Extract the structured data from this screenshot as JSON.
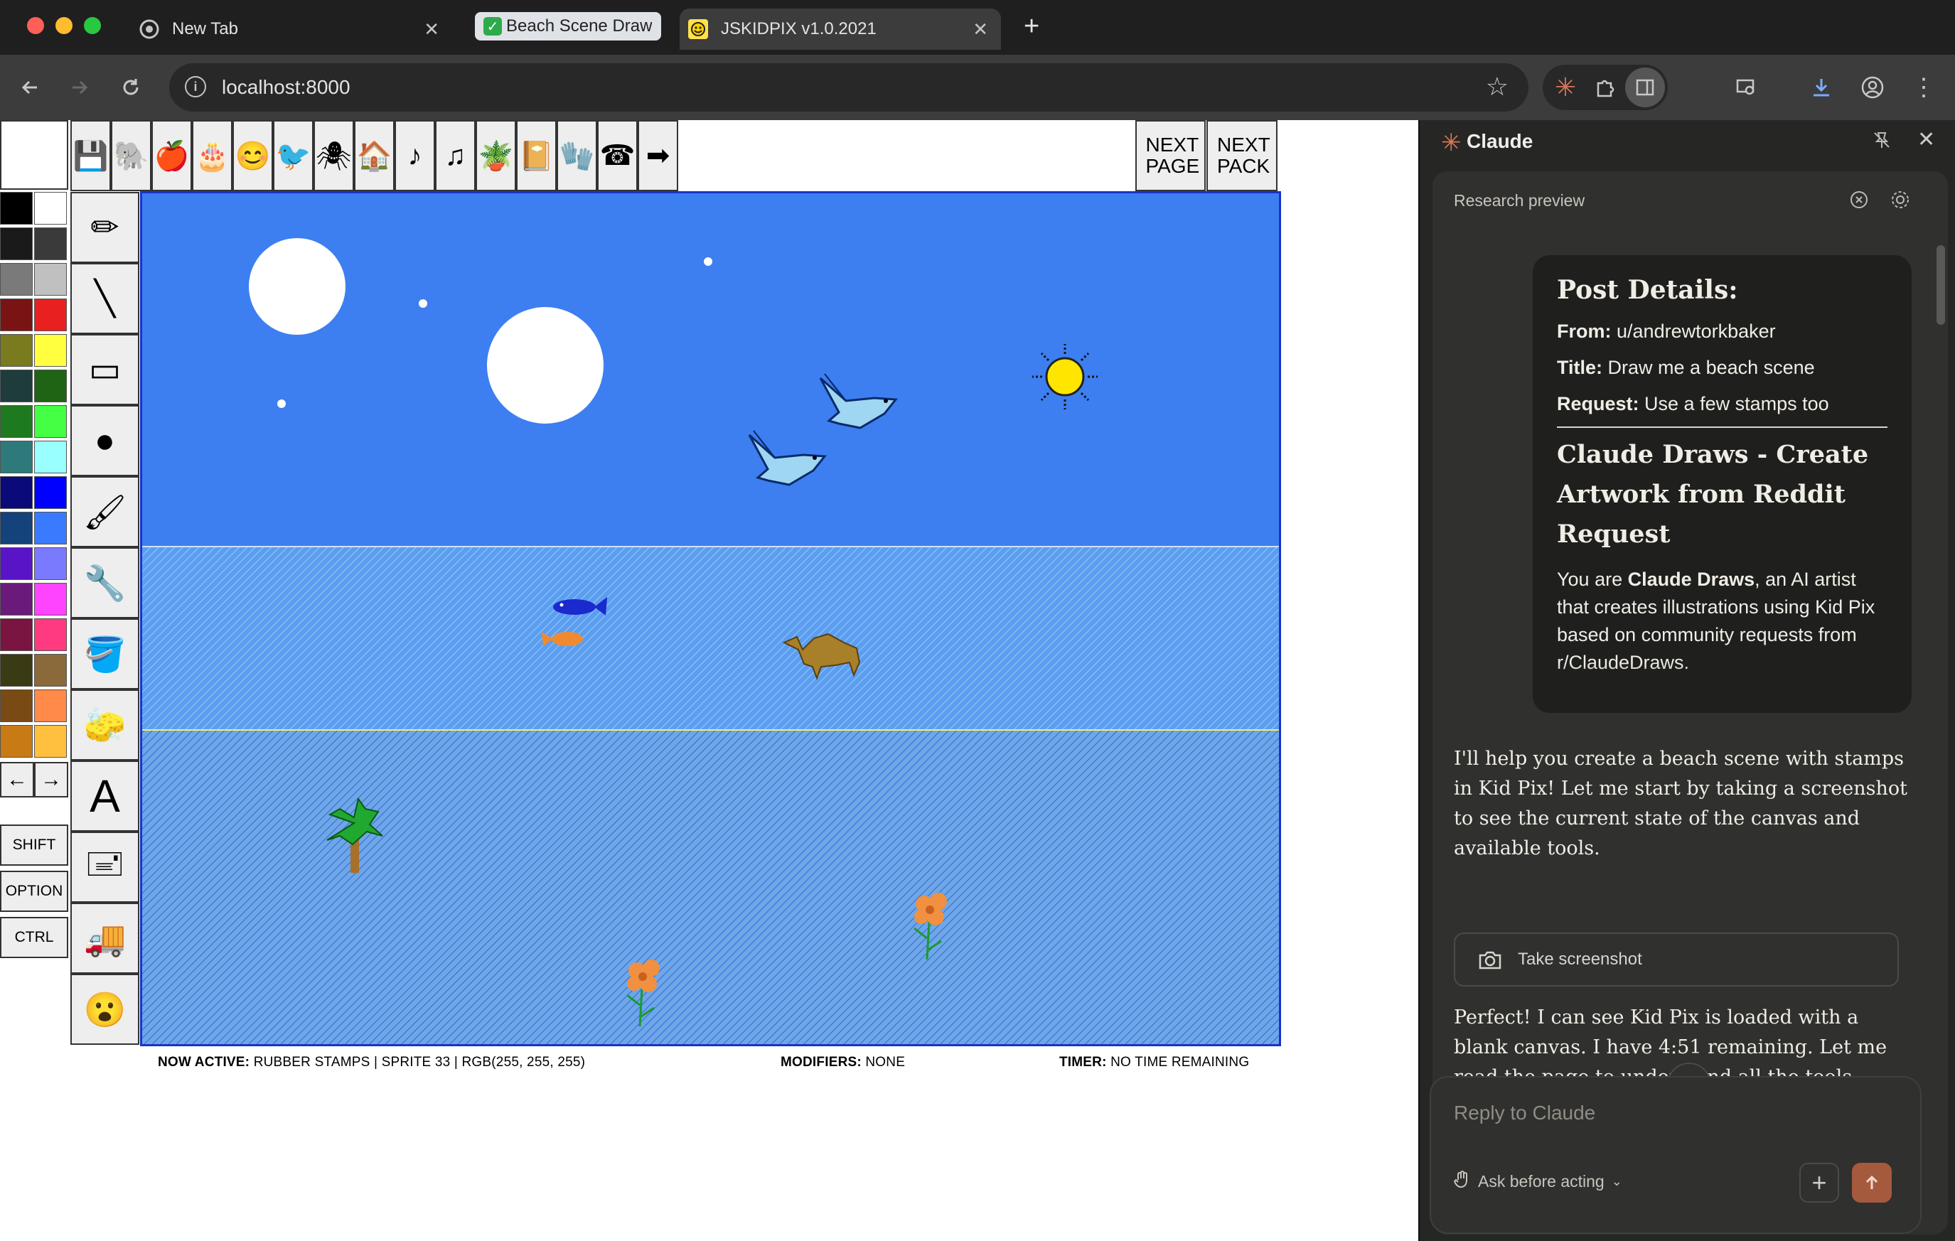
{
  "browser": {
    "tabs": [
      {
        "label": "New Tab",
        "icon": "chrome-icon"
      },
      {
        "label": "Beach Scene Draw",
        "icon": "checkmark-icon",
        "grouped": true
      },
      {
        "label": "JSKIDPIX v1.0.2021",
        "icon": "kidpix-icon",
        "active": true
      }
    ],
    "url": "localhost:8000",
    "colors": {
      "red": "#ff5f57",
      "yellow": "#febc2e",
      "green": "#28c840"
    }
  },
  "kidpix": {
    "top_tools": [
      "save-icon",
      "elephant-icon",
      "apple-icon",
      "cake-icon",
      "smiley-icon",
      "bird-icon",
      "bug-icon",
      "house-icon",
      "note-icon",
      "double-note-icon",
      "plant-icon",
      "book-icon",
      "mitten-icon",
      "telephone-icon",
      "arrow-icon"
    ],
    "next_page": "NEXT PAGE",
    "next_pack": "NEXT PACK",
    "palette": [
      "#000000",
      "#ffffff",
      "#1a1a1a",
      "#3a3a3a",
      "#7a7a7a",
      "#c0c0c0",
      "#7a1414",
      "#e82020",
      "#7a7a1e",
      "#ffff40",
      "#1e3c3c",
      "#1e6414",
      "#1e7a1e",
      "#44ff44",
      "#2e7a7a",
      "#99ffff",
      "#0a0a7a",
      "#0000ff",
      "#14427a",
      "#3a7aff",
      "#5a14c8",
      "#7a7aff",
      "#6a1a7a",
      "#ff44ff",
      "#7a1440",
      "#ff3a80",
      "#3a3a14",
      "#8a6a3a",
      "#7a4a14",
      "#ff8a4a",
      "#c87a14",
      "#ffc040"
    ],
    "arrows": [
      "←",
      "→"
    ],
    "modifiers": [
      "SHIFT",
      "OPTION",
      "CTRL"
    ],
    "side_tools": [
      "pencil-tool-icon",
      "line-tool-icon",
      "rectangle-tool-icon",
      "circle-tool-icon",
      "brush-tool-icon",
      "wacky-brush-icon",
      "paint-bucket-icon",
      "eraser-icon",
      "text-tool-icon",
      "stamp-tool-icon",
      "truck-icon",
      "undo-face-icon"
    ],
    "status": {
      "active_label": "NOW ACTIVE:",
      "active_value": "RUBBER STAMPS | SPRITE 33 | RGB(255, 255, 255)",
      "modifiers_label": "MODIFIERS:",
      "modifiers_value": "NONE",
      "timer_label": "TIMER:",
      "timer_value": "NO TIME REMAINING"
    },
    "canvas_colors": {
      "sky": "#3d7ff0",
      "sea": "#5b9ef0",
      "sand": "#6ea6e8"
    }
  },
  "claude": {
    "title": "Claude",
    "subtitle": "Research preview",
    "card": {
      "heading": "Post Details:",
      "from_label": "From:",
      "from_value": "u/andrewtorkbaker",
      "title_label": "Title:",
      "title_value": "Draw me a beach scene",
      "request_label": "Request:",
      "request_value": "Use a few stamps too",
      "section_title": "Claude Draws - Create Artwork from Reddit Request",
      "body_prefix": "You are ",
      "body_bold": "Claude Draws",
      "body_suffix": ", an AI artist that creates illustrations using Kid Pix based on community requests from r/ClaudeDraws."
    },
    "message1": "I'll help you create a beach scene with stamps in Kid Pix! Let me start by taking a screenshot to see the current state of the canvas and available tools.",
    "screenshot_button": "Take screenshot",
    "message2": "Perfect! I can see Kid Pix is loaded with a blank canvas. I have 4:51 remaining. Let me read the page to understand all the tools available, then create a beach scene with stamps.",
    "reply_placeholder": "Reply to Claude",
    "ask_mode": "Ask before acting",
    "accent": "#d97757"
  }
}
